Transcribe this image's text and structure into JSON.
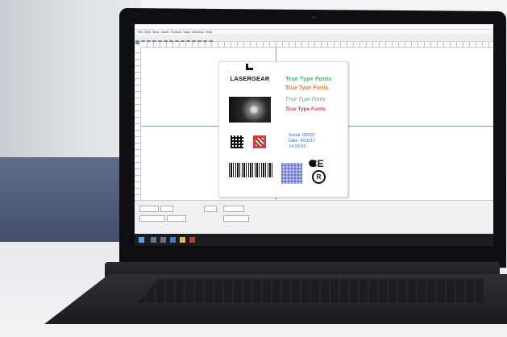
{
  "app": {
    "menu": [
      "File",
      "Edit",
      "View",
      "Insert",
      "Format",
      "Tools",
      "Window",
      "Help"
    ]
  },
  "label": {
    "logo_text": "LASERGEAR",
    "ttf_lines": [
      "True Type Fonts",
      "True Type Fonts",
      "True Type Fonts",
      "True Type Fonts"
    ],
    "serial_lines": [
      "Serial: 00020",
      "Date: 4/15/17",
      "14:03:06"
    ],
    "ce_mark": "CE",
    "registered_mark": "R"
  },
  "colors": {
    "ttf1": "#33c36b",
    "ttf2": "#f07a2c",
    "ttf3": "#4a9a6a",
    "ttf4": "#e0306f",
    "serial": "#2c6bd6",
    "datamatrix": "#6b76d6"
  }
}
